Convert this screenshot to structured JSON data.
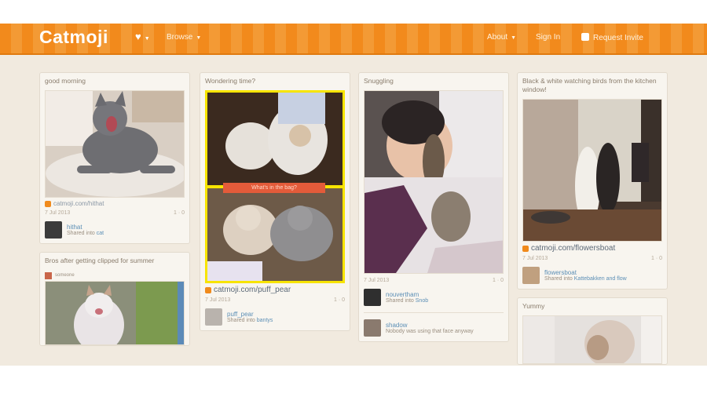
{
  "header": {
    "logo": "Catmoji",
    "heart": "♥",
    "browse": "Browse",
    "about": "About",
    "signin": "Sign In",
    "user": "Request Invite"
  },
  "cards": {
    "c1": {
      "title": "good morning",
      "source": "catmoji.com/hithat",
      "date": "7 Jul 2013",
      "counts": "1  ·  0",
      "user": "hithat",
      "sub_prefix": "Shared into",
      "sub_link": "cat"
    },
    "c2": {
      "title": "Bros after getting clipped for summer",
      "user": "someone"
    },
    "c3": {
      "title": "Wondering time?",
      "banner": "What's in the bag?",
      "source": "catmoji.com/puff_pear",
      "date": "7 Jul 2013",
      "counts": "1  ·  0",
      "user": "puff_pear",
      "sub_prefix": "Shared into",
      "sub_link": "bantys"
    },
    "c4": {
      "title": "Snuggling",
      "date": "7 Jul 2013",
      "counts": "1  ·  0",
      "user": "nouvertham",
      "sub_prefix": "Shared into",
      "sub_link": "Snob",
      "user2": "shadow",
      "sub2": "Nobody was using that face anyway"
    },
    "c5": {
      "title": "Black & white watching birds from the kitchen window!",
      "source": "catmoji.com/flowersboat",
      "date": "7 Jul 2013",
      "counts": "1  ·  0",
      "user": "flowersboat",
      "sub_prefix": "Shared into",
      "sub_link": "Kattebakken and flow"
    },
    "c6": {
      "title": "Yummy"
    }
  },
  "colors": {
    "brand": "#f28a1c",
    "link": "#5c8fb6",
    "highlight": "#f7e400"
  }
}
